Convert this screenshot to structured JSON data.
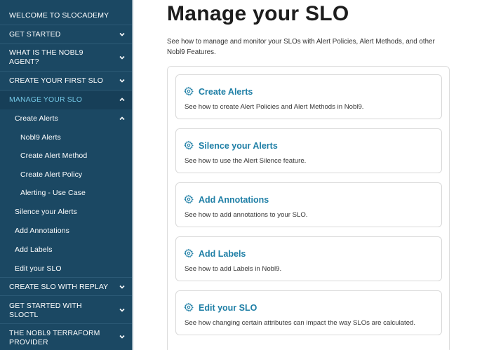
{
  "sidebar": {
    "items": [
      {
        "label": "WELCOME TO SLOCADEMY"
      },
      {
        "label": "GET STARTED",
        "chevron": "chevron-down-icon"
      },
      {
        "label": "WHAT IS THE NOBL9 AGENT?",
        "chevron": "chevron-down-icon"
      },
      {
        "label": "CREATE YOUR FIRST SLO",
        "chevron": "chevron-down-icon"
      },
      {
        "label": "MANAGE YOUR SLO",
        "chevron": "chevron-up-icon"
      },
      {
        "label": "Create Alerts",
        "chevron": "chevron-up-icon"
      },
      {
        "label": "Nobl9 Alerts"
      },
      {
        "label": "Create Alert Method"
      },
      {
        "label": "Create Alert Policy"
      },
      {
        "label": "Alerting - Use Case"
      },
      {
        "label": "Silence your Alerts"
      },
      {
        "label": "Add Annotations"
      },
      {
        "label": "Add Labels"
      },
      {
        "label": "Edit your SLO"
      },
      {
        "label": "CREATE SLO WITH REPLAY",
        "chevron": "chevron-down-icon"
      },
      {
        "label": "GET STARTED WITH SLOCTL",
        "chevron": "chevron-down-icon"
      },
      {
        "label": "THE NOBL9 TERRAFORM PROVIDER",
        "chevron": "chevron-down-icon"
      }
    ]
  },
  "main": {
    "title": "Manage your SLO",
    "intro": "See how to manage and monitor your SLOs with Alert Policies, Alert Methods, and other Nobl9 Features.",
    "cards": [
      {
        "title": "Create Alerts",
        "description": "See how to create Alert Policies and Alert Methods in Nobl9.",
        "icon": "gear-icon"
      },
      {
        "title": "Silence your Alerts",
        "description": "See how to use the Alert Silence feature.",
        "icon": "gear-icon"
      },
      {
        "title": "Add Annotations",
        "description": "See how to add annotations to your SLO.",
        "icon": "gear-icon"
      },
      {
        "title": "Add Labels",
        "description": "See how to add Labels in Nobl9.",
        "icon": "gear-icon"
      },
      {
        "title": "Edit your SLO",
        "description": "See how changing certain attributes can impact the way SLOs are calculated.",
        "icon": "gear-icon"
      }
    ]
  },
  "colors": {
    "sidebar_bg": "#1b4863",
    "active_link": "#74c8e6",
    "card_title": "#1f7fa6",
    "gear_icon": "#1f7fa6"
  }
}
